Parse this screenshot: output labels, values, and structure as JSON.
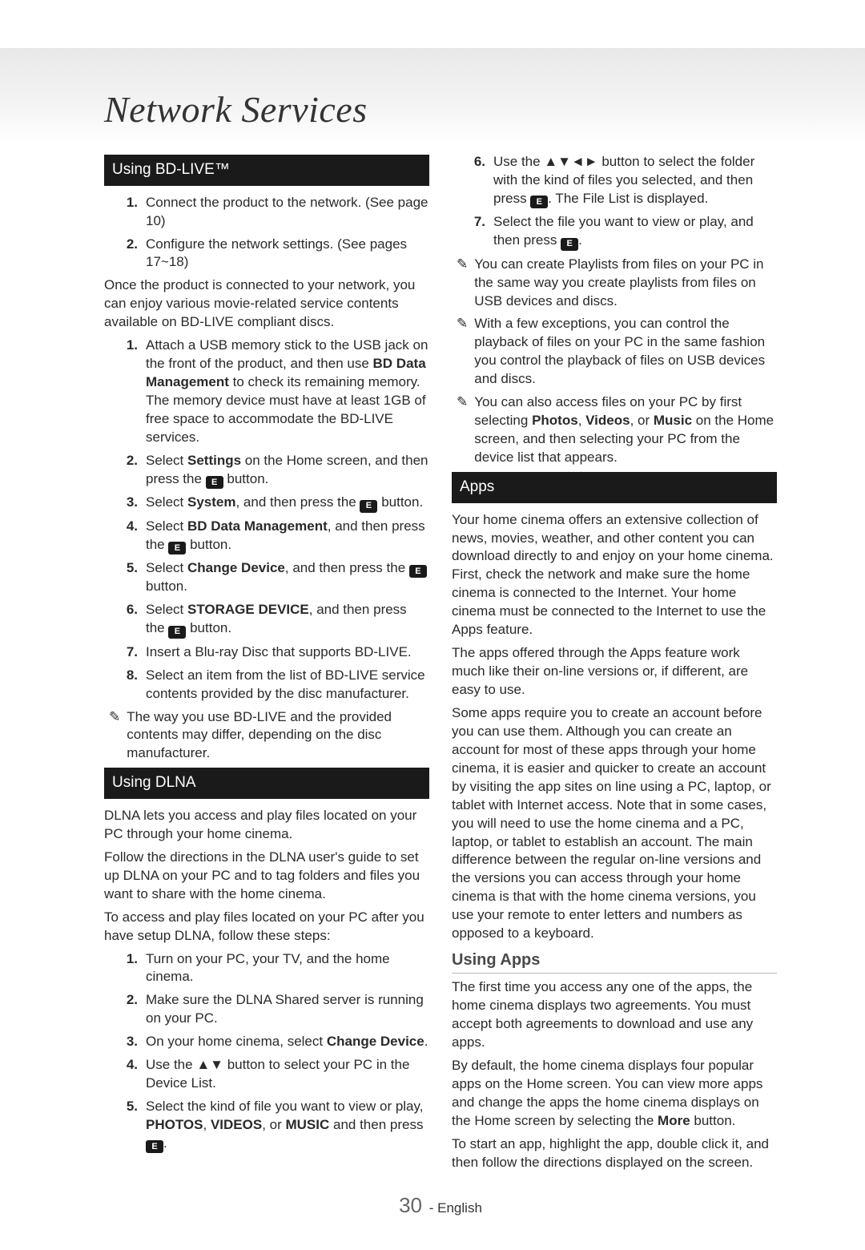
{
  "page_title": "Network Services",
  "left": {
    "bdlive": {
      "heading": "Using BD-LIVE™",
      "steps_a": [
        "Connect the product to the network. (See page 10)",
        "Configure the network settings. (See pages 17~18)"
      ],
      "intro": "Once the product is connected to your network, you can enjoy various movie-related service contents available on BD-LIVE compliant discs.",
      "steps_b": [
        {
          "pre": "Attach a USB memory stick to the USB jack on the front of the product, and then use ",
          "b1": "BD Data Management",
          "post": " to check its remaining memory. The memory device must have at least 1GB of free space to accommodate the BD-LIVE services."
        },
        {
          "pre": "Select ",
          "b1": "Settings",
          "mid": " on the Home screen, and then press the ",
          "enter": true,
          "post": " button."
        },
        {
          "pre": "Select ",
          "b1": "System",
          "mid": ", and then press the ",
          "enter": true,
          "post": " button."
        },
        {
          "pre": "Select ",
          "b1": "BD Data Management",
          "mid": ", and then press the ",
          "enter": true,
          "post": " button."
        },
        {
          "pre": "Select ",
          "b1": "Change Device",
          "mid": ", and then press the ",
          "enter": true,
          "post": " button."
        },
        {
          "pre": "Select ",
          "b1": "STORAGE DEVICE",
          "mid": ", and then press the ",
          "enter": true,
          "post": " button."
        },
        {
          "pre": "Insert a Blu-ray Disc that supports BD-LIVE."
        },
        {
          "pre": "Select an item from the list of BD-LIVE service contents provided by the disc manufacturer."
        }
      ],
      "note": "The way you use BD-LIVE and the provided contents may differ, depending on the disc manufacturer."
    },
    "dlna": {
      "heading": "Using DLNA",
      "p1": "DLNA lets you access and play files located on your PC through your home cinema.",
      "p2": "Follow the directions in the DLNA user's guide to set up DLNA on your PC and to tag folders and files you want to share with the home cinema.",
      "p3": "To access and play files located on your PC after you have setup DLNA, follow these steps:",
      "steps": [
        {
          "txt": "Turn on your PC, your TV, and the home cinema."
        },
        {
          "txt": "Make sure the DLNA Shared server is running on your PC."
        },
        {
          "pre": "On your home cinema, select ",
          "b1": "Change Device",
          "post": "."
        },
        {
          "pre": "Use the ",
          "arrows": "▲▼",
          "post": " button to select your PC in the Device List."
        },
        {
          "pre": "Select the kind of file you want to view or play, ",
          "b1": "PHOTOS",
          "mid1": ", ",
          "b2": "VIDEOS",
          "mid2": ", or ",
          "b3": "MUSIC",
          "post": " and then press ",
          "enter": true,
          "tail": "."
        }
      ]
    }
  },
  "right": {
    "dlna_cont": {
      "step6": {
        "num": "6.",
        "pre": "Use the ",
        "arrows": "▲▼◄►",
        "mid": " button to select the folder with the kind of files you selected, and then press ",
        "enter": true,
        "post": ". The File List is displayed."
      },
      "step7": {
        "num": "7.",
        "pre": "Select the file you want to view or play, and then press ",
        "enter": true,
        "post": "."
      },
      "notes": [
        "You can create Playlists from files on your PC in the same way you create playlists from files on USB devices and discs.",
        "With a few exceptions, you can control the playback of files on your PC in the same fashion you control the playback of files on USB devices and discs.",
        {
          "pre": "You can also access files on your PC by first selecting ",
          "b1": "Photos",
          "mid1": ", ",
          "b2": "Videos",
          "mid2": ", or ",
          "b3": "Music",
          "post": " on the Home screen, and then selecting your PC from the device list that appears."
        }
      ]
    },
    "apps": {
      "heading": "Apps",
      "p1": "Your home cinema offers an extensive collection of news, movies, weather, and other content you can download directly to and enjoy on your home cinema. First, check the network and make sure the home cinema is connected to the Internet. Your home cinema must be connected to the Internet to use the Apps feature.",
      "p2": "The apps offered through the Apps feature work much like their on-line versions or, if different, are easy to use.",
      "p3": "Some apps require you to create an account before you can use them. Although you can create an account for most of these apps through your home cinema, it is easier and quicker to create an account by visiting the app sites on line using a PC, laptop, or tablet with Internet access. Note that in some cases, you will need to use the home cinema and a PC, laptop, or tablet to establish an account. The main difference between the regular on-line versions and the versions you can access through your home cinema is that with the home cinema versions, you use your remote to enter letters and numbers as opposed to a keyboard.",
      "using_heading": "Using Apps",
      "u1": "The first time you access any one of the apps, the home cinema displays two agreements. You must accept both agreements to download and use any apps.",
      "u2": {
        "pre": "By default, the home cinema displays four popular apps on the Home screen. You can view more apps and change the apps the home cinema displays on the Home screen by selecting the ",
        "b1": "More",
        "post": " button."
      },
      "u3": "To start an app, highlight the app, double click it, and then follow the directions displayed on the screen."
    }
  },
  "footer": {
    "page": "30",
    "lang": "English"
  }
}
